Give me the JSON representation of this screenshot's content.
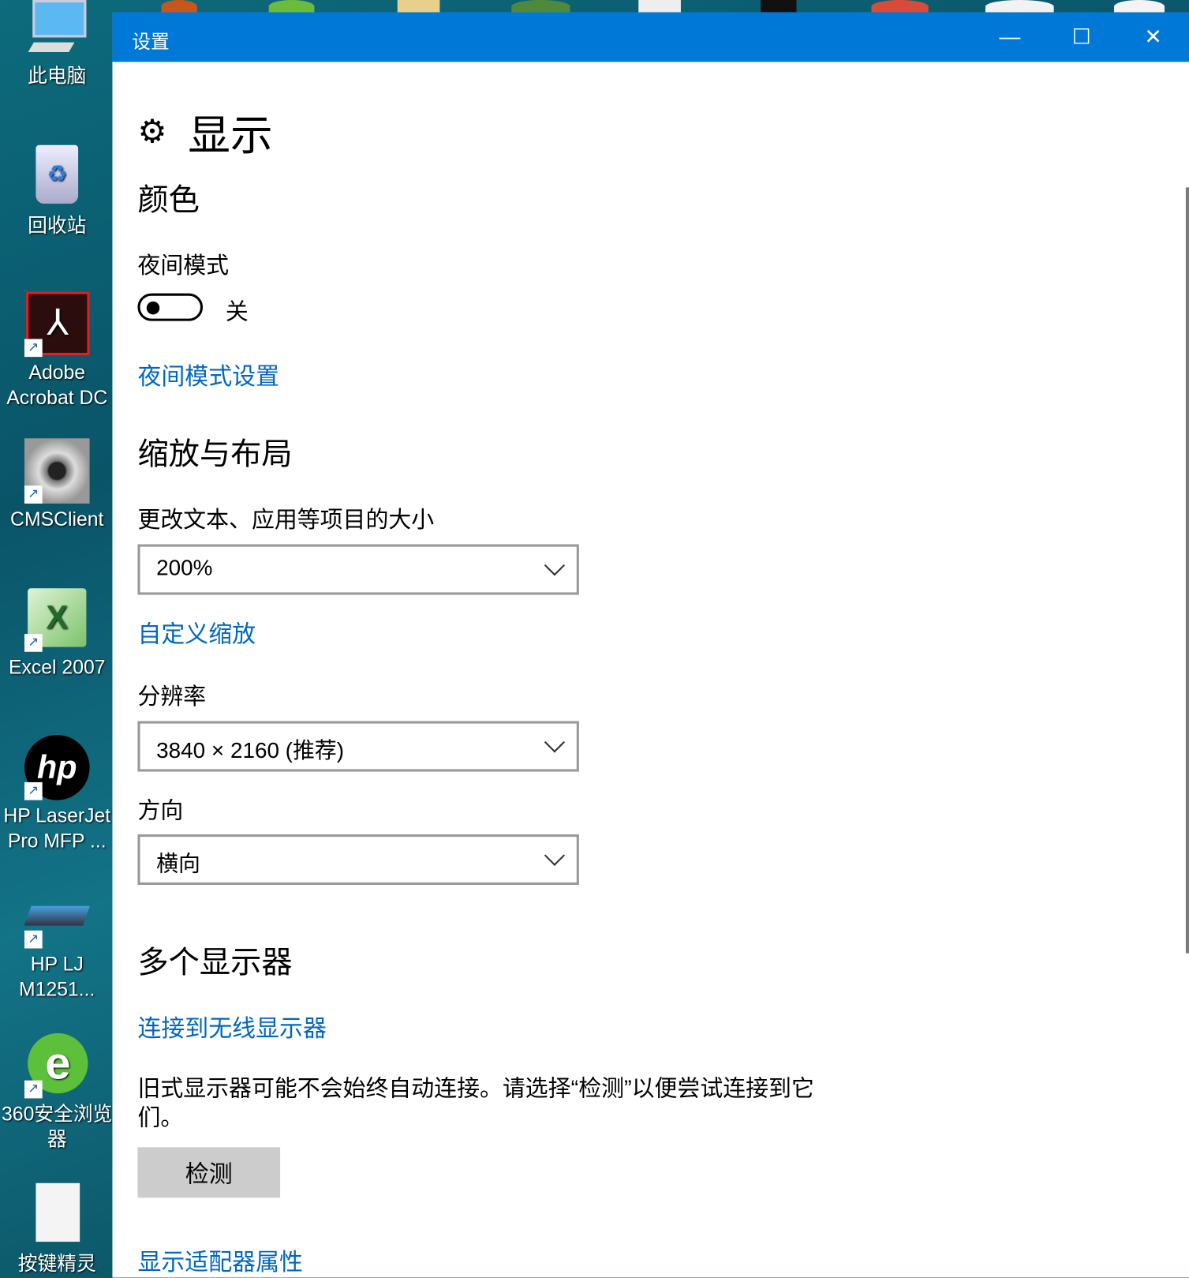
{
  "desktop": {
    "icons": [
      {
        "label": "此电脑",
        "icon": "computer-icon"
      },
      {
        "label": "回收站",
        "icon": "recycle-bin-icon"
      },
      {
        "label": "Adobe Acrobat DC",
        "icon": "acrobat-icon"
      },
      {
        "label": "CMSClient",
        "icon": "camera-icon"
      },
      {
        "label": "Excel 2007",
        "icon": "excel-icon"
      },
      {
        "label": "HP LaserJet Pro MFP ...",
        "icon": "hp-icon"
      },
      {
        "label": "HP LJ M1251...",
        "icon": "scanner-icon"
      },
      {
        "label": "360安全浏览器",
        "icon": "browser-360-icon"
      },
      {
        "label": "按键精灵",
        "icon": "file-icon"
      }
    ]
  },
  "window": {
    "title": "设置",
    "minimize": "—",
    "maximize": "☐",
    "close": "✕",
    "page_title": "显示",
    "sections": {
      "color": {
        "heading": "颜色",
        "night_mode_label": "夜间模式",
        "night_mode_state": "关",
        "night_mode_on": false,
        "night_mode_link": "夜间模式设置"
      },
      "scale": {
        "heading": "缩放与布局",
        "size_label": "更改文本、应用等项目的大小",
        "size_value": "200%",
        "custom_link": "自定义缩放",
        "resolution_label": "分辨率",
        "resolution_value": "3840 × 2160 (推荐)",
        "orientation_label": "方向",
        "orientation_value": "横向"
      },
      "multi": {
        "heading": "多个显示器",
        "wireless_link": "连接到无线显示器",
        "info": "旧式显示器可能不会始终自动连接。请选择“检测”以便尝试连接到它们。",
        "detect_button": "检测",
        "adapter_link": "显示适配器属性"
      }
    }
  },
  "colors": {
    "accent": "#0078d7",
    "link": "#0067c0"
  }
}
